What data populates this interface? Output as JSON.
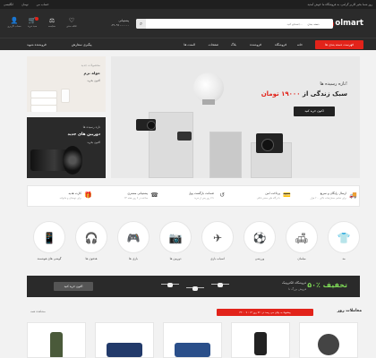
{
  "topbar": {
    "welcome": "روز شما بخیر کاربر گرامی، به فروشگاه ما خوش آمدید",
    "lang": "انگلیسی",
    "currency": "تومان",
    "account": "حساب من"
  },
  "header": {
    "logo": "olmart",
    "logo_mark": "o",
    "search_placeholder": "جستجو کنید...",
    "search_category": "دسته بندی",
    "search_icon": "search-icon",
    "phone_label": "پشتیبانی",
    "phone_number": "۰۲۱-۹۱۰۰۰۰۰۰",
    "icons": [
      {
        "label": "سبد خرید",
        "glyph": "🛒",
        "icon": "cart-icon"
      },
      {
        "label": "مقایسه",
        "glyph": "⚖",
        "icon": "compare-icon"
      },
      {
        "label": "علاقه مندی",
        "glyph": "♡",
        "icon": "heart-icon"
      },
      {
        "label": "حساب کاربری",
        "glyph": "👤",
        "icon": "user-icon"
      }
    ]
  },
  "nav": {
    "cta": "فهرست دسته بندی ها",
    "items": [
      "خانه",
      "فروشگاه",
      "فروشنده",
      "بلاگ",
      "صفحات",
      "المنت ها"
    ],
    "right_links": [
      "پیگیری سفارش",
      "فروشنده شوید"
    ]
  },
  "hero": {
    "kicker": "تازه رسیده ها!",
    "title_a": "سبک زندگی از",
    "title_b": "۱۹۰۰۰ تومان",
    "button": "اکنون خرید کنید"
  },
  "side_banners": [
    {
      "kicker": "محصولات جدید",
      "title": "حوله نرم",
      "sub": "اکنون بخرید"
    },
    {
      "kicker": "تازه رسیده ها",
      "title": "دوربین های جدید",
      "sub": "اکنون بخرید"
    }
  ],
  "features": [
    {
      "title": "ارسال رایگان و سریع",
      "sub": "برای تمامی سفارشات بالای ۲۰۰ هزار",
      "icon": "truck-icon",
      "glyph": "🚚"
    },
    {
      "title": "پرداخت امن",
      "sub": "با درگاه های معتبر بانکی",
      "icon": "card-icon",
      "glyph": "💳"
    },
    {
      "title": "ضمانت بازگشت پول",
      "sub": "تا ۷ روز پس از خرید",
      "icon": "refund-icon",
      "glyph": "↺"
    },
    {
      "title": "پشتیبانی مشتری",
      "sub": "۲۴ ساعته در ۷ روز هفته",
      "icon": "support-icon",
      "glyph": "☎"
    },
    {
      "title": "کارت هدیه",
      "sub": "برای دوستان و خانواده",
      "icon": "gift-icon",
      "glyph": "🎁"
    }
  ],
  "categories": [
    {
      "label": "مد",
      "icon": "tshirt-icon",
      "glyph": "👕"
    },
    {
      "label": "مبلمان",
      "icon": "sofa-icon",
      "glyph": "🛋"
    },
    {
      "label": "ورزشی",
      "icon": "ball-icon",
      "glyph": "⚽"
    },
    {
      "label": "اسباب بازی",
      "icon": "plane-icon",
      "glyph": "✈"
    },
    {
      "label": "دوربین ها",
      "icon": "camera-icon",
      "glyph": "📷"
    },
    {
      "label": "بازی ها",
      "icon": "gamepad-icon",
      "glyph": "🎮"
    },
    {
      "label": "هدفون ها",
      "icon": "headphones-icon",
      "glyph": "🎧"
    },
    {
      "label": "گوشی های هوشمند",
      "icon": "smartphone-icon",
      "glyph": "📱"
    }
  ],
  "promo": {
    "percent": "۵۰٪ تخفیف",
    "title": "فروشگاه الکترونیک",
    "sub": "فروش بزرگ تا",
    "button": "اکنون خرید کنید"
  },
  "deals": {
    "title": "معاملات روز",
    "timer": "پیشنهاد به پایان می رسد در: ۷۶ روز ۱۴ : ۰۷ : ۳۲",
    "all": "مشاهده همه"
  },
  "colors": {
    "accent": "#e2231a",
    "dark": "#2b2b2b",
    "promo_green": "#7ed957"
  }
}
